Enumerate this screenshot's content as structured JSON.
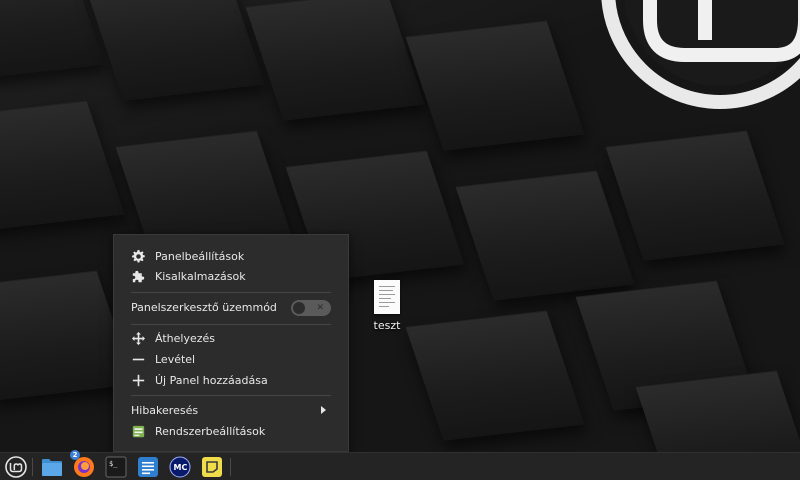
{
  "desktop": {
    "file": {
      "name": "teszt",
      "icon": "text-document-icon"
    }
  },
  "context_menu": {
    "items": [
      {
        "label": "Panelbeállítások",
        "icon": "gear-icon"
      },
      {
        "label": "Kisalkalmazások",
        "icon": "puzzle-icon"
      }
    ],
    "edit_mode": {
      "label": "Panelszerkesztő üzemmód",
      "enabled": false
    },
    "panel_items": [
      {
        "label": "Áthelyezés",
        "icon": "move-arrows-icon"
      },
      {
        "label": "Levétel",
        "icon": "minus-icon"
      },
      {
        "label": "Új Panel hozzáadása",
        "icon": "plus-icon"
      }
    ],
    "troubleshoot": {
      "label": "Hibakeresés"
    },
    "system_settings": {
      "label": "Rendszerbeállítások",
      "icon": "system-settings-icon"
    }
  },
  "taskbar": {
    "apps": [
      {
        "name": "linux-mint-menu-icon"
      },
      {
        "name": "file-manager-icon"
      },
      {
        "name": "firefox-icon",
        "badge": "2"
      },
      {
        "name": "terminal-icon"
      },
      {
        "name": "text-editor-icon"
      },
      {
        "name": "midnight-commander-icon"
      },
      {
        "name": "sticky-notes-icon"
      }
    ]
  }
}
